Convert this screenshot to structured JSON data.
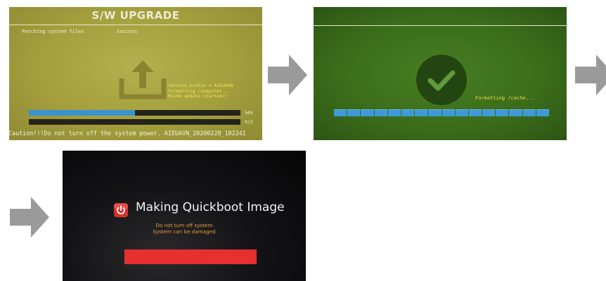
{
  "screen1": {
    "title": "S/W UPGRADE",
    "status_label": "Patching system files",
    "status_value": "Success",
    "log_lines": [
      "version_prefix = AIEUAVN",
      "Formatting /snapshot...",
      "Micom update started!!"
    ],
    "progress_percent_label": "50%",
    "progress_fraction": 0.5,
    "count_label": "0/2",
    "caution": "Caution!!!Do not turn off the system power. AIEUAVN_20200228_102241",
    "icon": "upload-icon"
  },
  "screen2": {
    "message": "Formatting /cache...",
    "icon": "checkmark-icon",
    "segments": 16
  },
  "screen3": {
    "heading": "Making Quickboot Image",
    "warning_line1": "Do not turn off system",
    "warning_line2": "System can be damaged",
    "icon": "power-logo-icon"
  },
  "arrows": [
    "arrow-right-icon",
    "arrow-right-icon",
    "arrow-right-icon"
  ],
  "colors": {
    "s1_bg": "#a39f3d",
    "s1_log_text": "#f1e552",
    "progress_blue": "#3a93cf",
    "s2_bg": "#3a6b1a",
    "s3_bg": "#0b0b0c",
    "s3_warning": "#e89a3a",
    "s3_red_bar": "#e6302f",
    "arrow_gray": "#9a9a9a"
  }
}
